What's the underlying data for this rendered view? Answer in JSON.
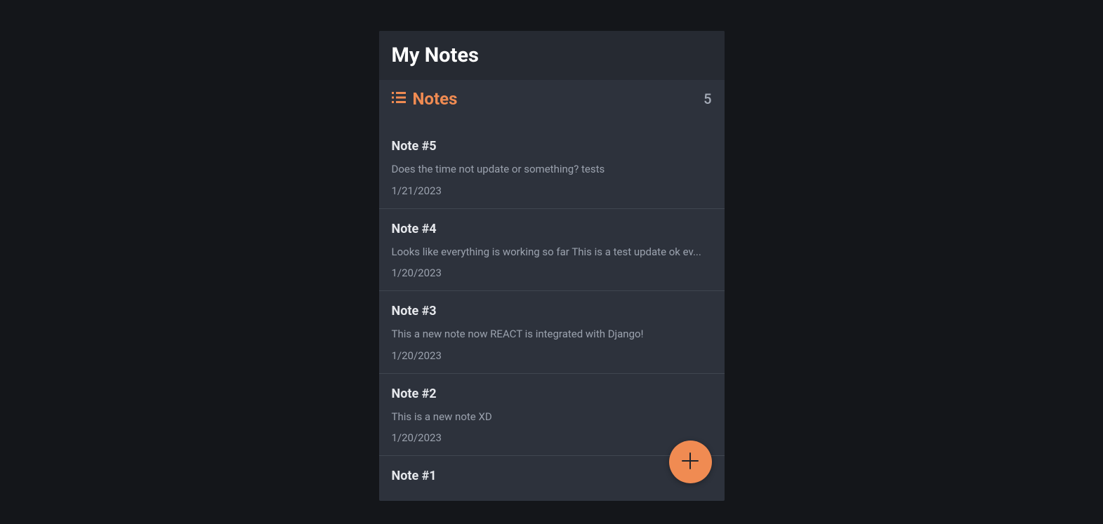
{
  "header": {
    "title": "My Notes"
  },
  "subheader": {
    "label": "Notes",
    "count": "5"
  },
  "notes": [
    {
      "title": "Note #5",
      "preview": "Does the time not update or something? tests",
      "date": "1/21/2023"
    },
    {
      "title": "Note #4",
      "preview": "Looks like everything is working so far This is a test update ok ev...",
      "date": "1/20/2023"
    },
    {
      "title": "Note #3",
      "preview": "This a new note now REACT is integrated with Django!",
      "date": "1/20/2023"
    },
    {
      "title": "Note #2",
      "preview": "This is a new note XD",
      "date": "1/20/2023"
    },
    {
      "title": "Note #1",
      "preview": "",
      "date": ""
    }
  ],
  "colors": {
    "accent": "#f08b52",
    "background": "#14161a",
    "panel": "#2d323c",
    "header": "#262a32"
  }
}
